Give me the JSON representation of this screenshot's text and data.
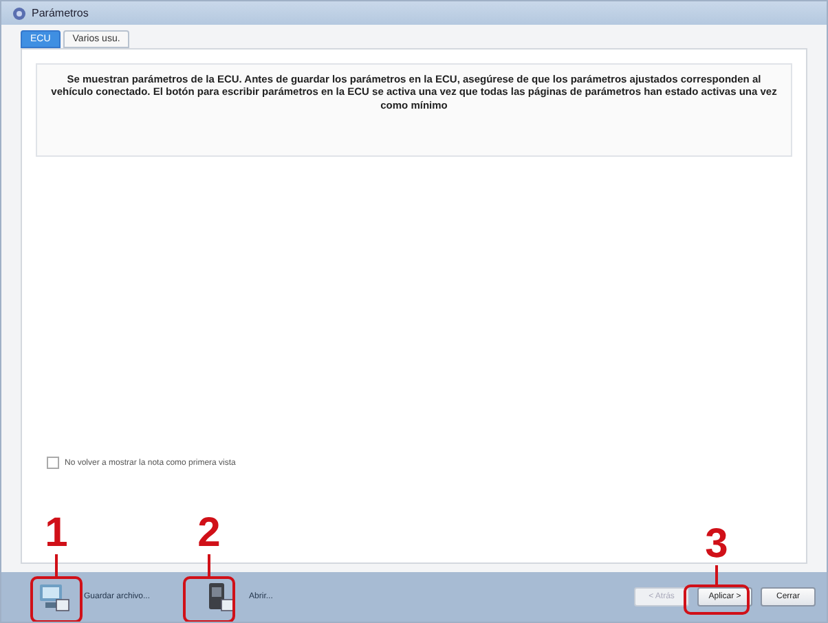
{
  "window": {
    "title": "Parámetros"
  },
  "tabs": [
    {
      "label": "ECU",
      "selected": true
    },
    {
      "label": "Varios usu.",
      "selected": false
    }
  ],
  "message": "Se muestran parámetros de la ECU. Antes de guardar los parámetros en la ECU, asegúrese de que los parámetros ajustados corresponden al vehículo conectado. El botón para escribir parámetros en la ECU se activa una vez que todas las páginas de parámetros han estado activas una vez como mínimo",
  "option": {
    "label": "No volver a mostrar la nota como primera vista",
    "checked": false
  },
  "tools": [
    {
      "kind": "save",
      "label": "Guardar archivo..."
    },
    {
      "kind": "open",
      "label": "Abrir..."
    }
  ],
  "buttons": [
    {
      "label": "< Atrás",
      "disabled": true
    },
    {
      "label": "Aplicar >",
      "disabled": false
    },
    {
      "label": "Cerrar",
      "disabled": false
    }
  ],
  "callouts": [
    {
      "label": "1"
    },
    {
      "label": "2"
    },
    {
      "label": "3"
    }
  ]
}
